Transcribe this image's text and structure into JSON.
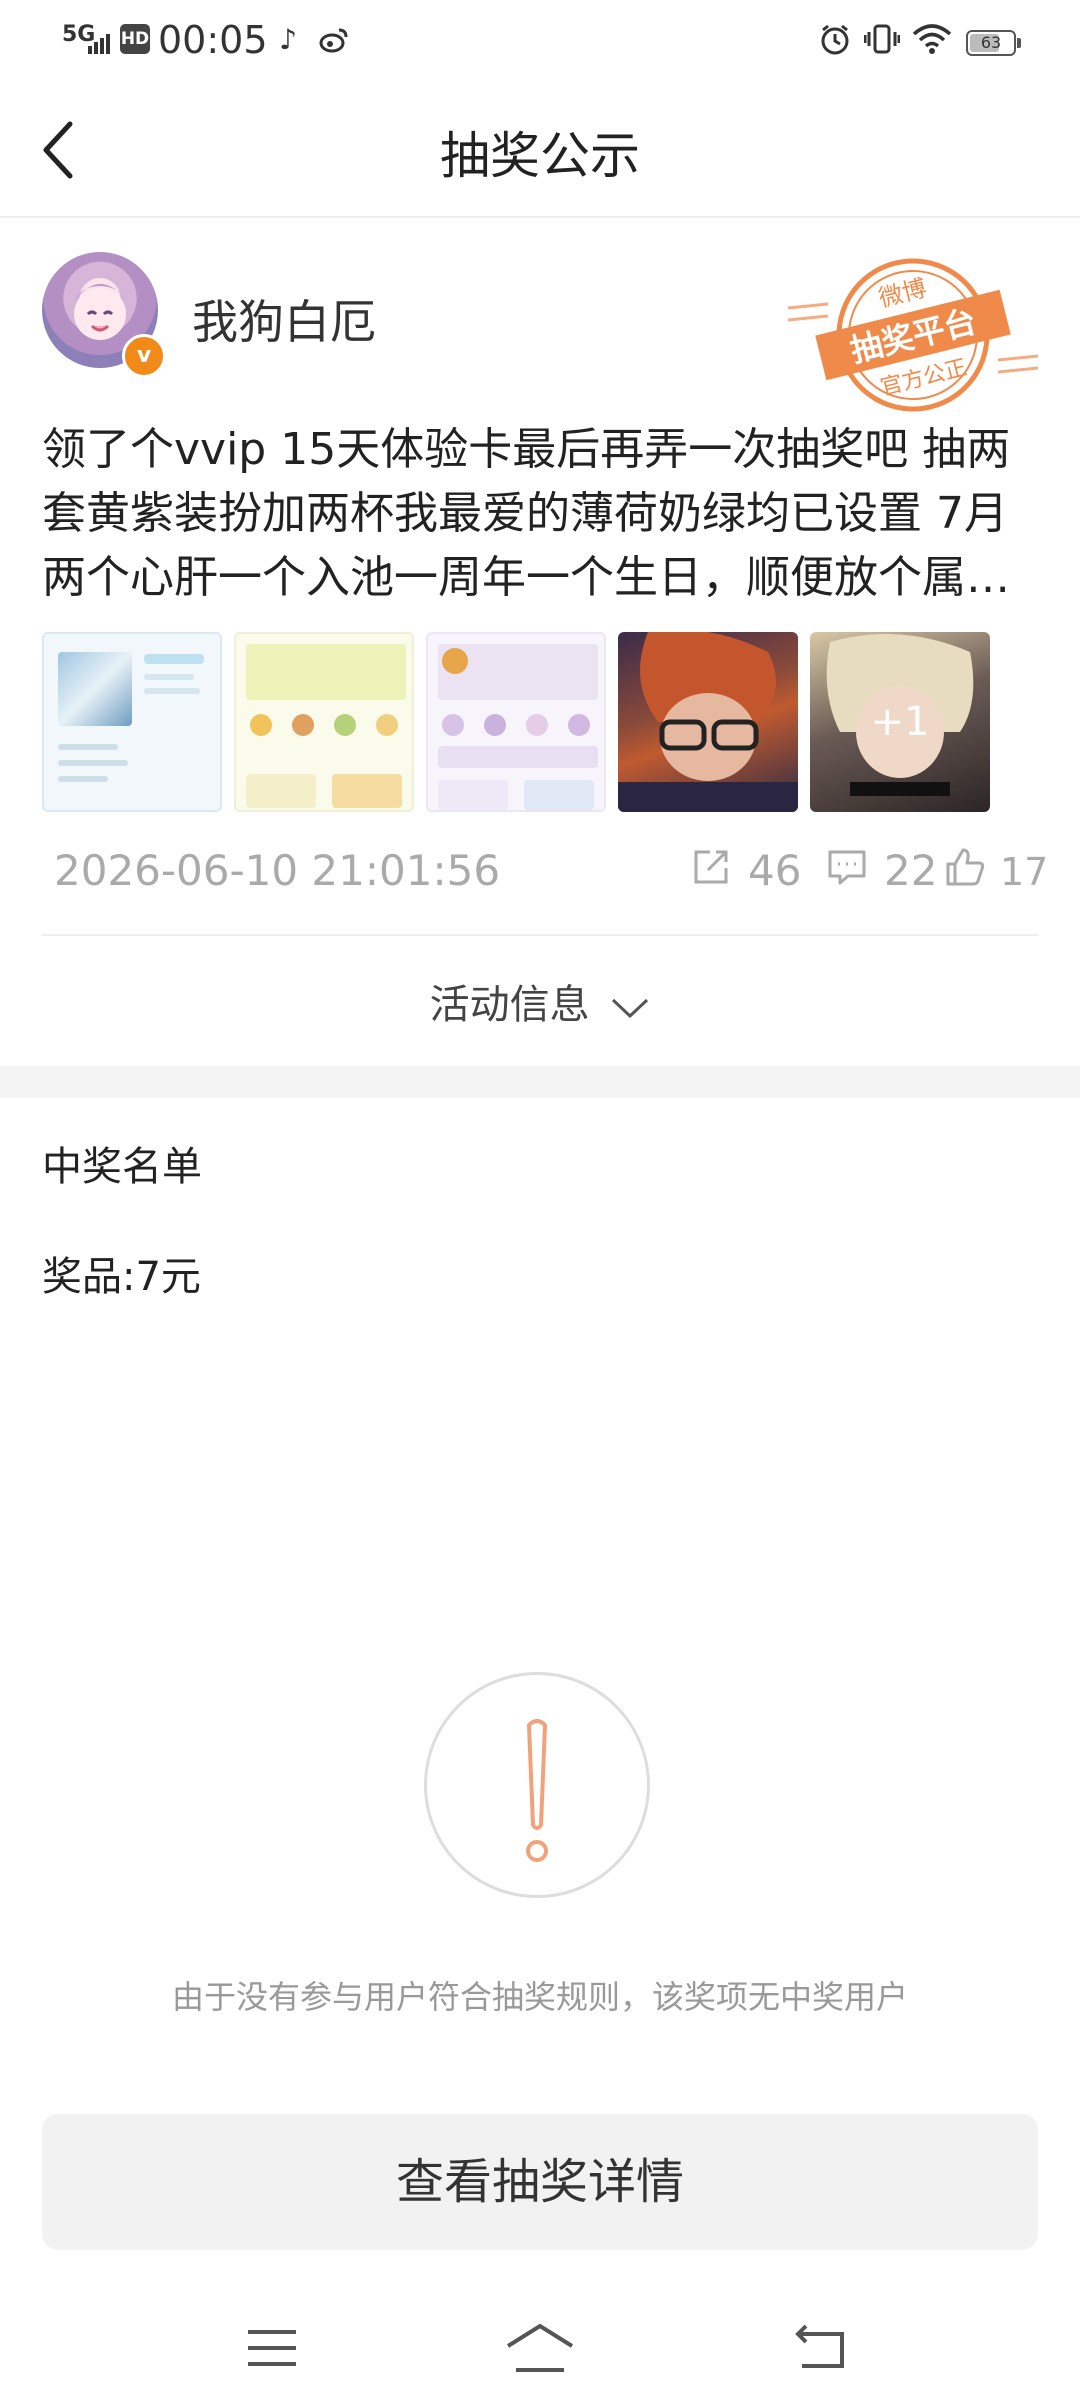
{
  "status_bar": {
    "network": "5G",
    "hd": "HD",
    "time": "00:05",
    "battery": "63",
    "icons": [
      "tiktok-icon",
      "weibo-icon",
      "alarm-icon",
      "vibrate-icon",
      "wifi-icon"
    ]
  },
  "nav": {
    "title": "抽奖公示"
  },
  "post": {
    "username": "我狗白厄",
    "stamp": {
      "top": "微博",
      "main": "抽奖平台",
      "bottom": "官方公正"
    },
    "text_lines": [
      "领了个vvip 15天体验卡最后再弄一次抽奖吧 抽两",
      "套黄紫装扮加两杯我最爱的薄荷奶绿均已设置 7月",
      "两个心肝一个入池一周年一个生日，顺便放个属…"
    ],
    "more_images": "+1",
    "time": "2026-06-10 21:01:56",
    "reposts": "46",
    "comments": "22",
    "likes": "17"
  },
  "activity": {
    "label": "活动信息"
  },
  "winners": {
    "title": "中奖名单",
    "prize": "奖品:7元",
    "empty_message": "由于没有参与用户符合抽奖规则，该奖项无中奖用户"
  },
  "button": {
    "label": "查看抽奖详情"
  },
  "colors": {
    "accent": "#f28a1a",
    "stamp": "#f08a4b",
    "muted": "#aaaaaa"
  }
}
